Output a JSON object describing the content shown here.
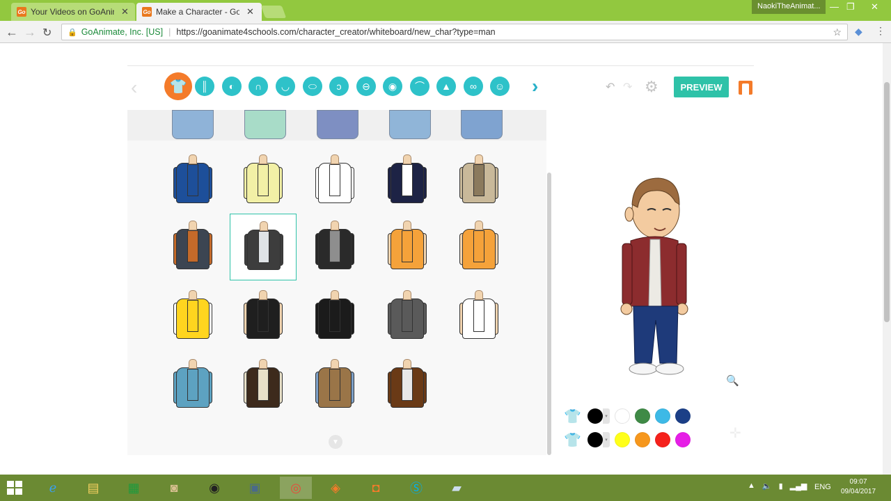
{
  "browser": {
    "tabs": [
      {
        "title": "Your Videos on GoAnim",
        "favicon": "Go",
        "close": "✕",
        "active": false
      },
      {
        "title": "Make a Character - GoA",
        "favicon": "Go",
        "close": "✕",
        "active": true
      }
    ],
    "profile": "NaokiTheAnimat...",
    "site_identity": "GoAnimate, Inc. [US]",
    "url": "https://goanimate4schools.com/character_creator/whiteboard/new_char?type=man"
  },
  "toolbar": {
    "categories": [
      {
        "name": "upper-body-icon",
        "glyph": "👕",
        "active": true
      },
      {
        "name": "lower-body-icon",
        "glyph": "║",
        "active": false
      },
      {
        "name": "face-shape-icon",
        "glyph": "◐",
        "active": false
      },
      {
        "name": "hair-icon",
        "glyph": "∩",
        "active": false
      },
      {
        "name": "head-icon",
        "glyph": "◡",
        "active": false
      },
      {
        "name": "mouth-icon",
        "glyph": "⬭",
        "active": false
      },
      {
        "name": "ear-icon",
        "glyph": "ↄ",
        "active": false
      },
      {
        "name": "skin-icon",
        "glyph": "⊖",
        "active": false
      },
      {
        "name": "eye-icon",
        "glyph": "◉",
        "active": false
      },
      {
        "name": "eyebrow-icon",
        "glyph": "⌒",
        "active": false
      },
      {
        "name": "nose-icon",
        "glyph": "▲",
        "active": false
      },
      {
        "name": "glasses-icon",
        "glyph": "∞",
        "active": false
      },
      {
        "name": "accessory-icon",
        "glyph": "☺",
        "active": false
      }
    ],
    "preview_label": "PREVIEW"
  },
  "outfits": [
    {
      "row": 0,
      "col": 0,
      "color": "#1d4f9a",
      "shirt": "#1d4f9a",
      "arms": "#1d4f9a"
    },
    {
      "row": 0,
      "col": 1,
      "color": "#f2f0a6",
      "shirt": "#f2f0a6",
      "arms": "#f2f0a6"
    },
    {
      "row": 0,
      "col": 2,
      "color": "#ffffff",
      "shirt": "#ffffff",
      "arms": "#ffffff"
    },
    {
      "row": 0,
      "col": 3,
      "color": "#1d2345",
      "shirt": "#ffffff",
      "arms": "#1d2345"
    },
    {
      "row": 0,
      "col": 4,
      "color": "#c9b99a",
      "shirt": "#8b7a5d",
      "arms": "#c9b99a"
    },
    {
      "row": 1,
      "col": 0,
      "color": "#3c4552",
      "shirt": "#c46a2a",
      "arms": "#c46a2a"
    },
    {
      "row": 1,
      "col": 1,
      "color": "#3d3d3d",
      "shirt": "#dfe3e6",
      "arms": "#3d3d3d",
      "selected": true
    },
    {
      "row": 1,
      "col": 2,
      "color": "#2a2a2a",
      "shirt": "#8e8e8e",
      "arms": "#2a2a2a"
    },
    {
      "row": 1,
      "col": 3,
      "color": "#f5a23a",
      "shirt": "#f5a23a",
      "arms": "#f1d4b0"
    },
    {
      "row": 1,
      "col": 4,
      "color": "#f5a23a",
      "shirt": "#f5a23a",
      "arms": "#f1d4b0"
    },
    {
      "row": 2,
      "col": 0,
      "color": "#ffd51f",
      "shirt": "#ffd51f",
      "arms": "#ffffff"
    },
    {
      "row": 2,
      "col": 1,
      "color": "#1f1f1f",
      "shirt": "#1f1f1f",
      "arms": "#f1d4b0"
    },
    {
      "row": 2,
      "col": 2,
      "color": "#1b1b1b",
      "shirt": "#1b1b1b",
      "arms": "#1b1b1b"
    },
    {
      "row": 2,
      "col": 3,
      "color": "#5a5a5a",
      "shirt": "#5a5a5a",
      "arms": "#5a5a5a"
    },
    {
      "row": 2,
      "col": 4,
      "color": "#ffffff",
      "shirt": "#ffffff",
      "arms": "#f1d4b0"
    },
    {
      "row": 3,
      "col": 0,
      "color": "#5da2c1",
      "shirt": "#5da2c1",
      "arms": "#5da2c1"
    },
    {
      "row": 3,
      "col": 1,
      "color": "#3d2a1c",
      "shirt": "#e8e0c8",
      "arms": "#e8e0c8"
    },
    {
      "row": 3,
      "col": 2,
      "color": "#9a7548",
      "shirt": "#9a7548",
      "arms": "#7ea1c9"
    },
    {
      "row": 3,
      "col": 3,
      "color": "#6a3a16",
      "shirt": "#e8e8e8",
      "arms": "#6a3a16"
    }
  ],
  "partial_top_row": [
    "#8fb3d8",
    "#a8dcc8",
    "#7e8fc2",
    "#90b5d8",
    "#7fa3d0"
  ],
  "colors": {
    "row1": [
      "#000000",
      "#ffffff",
      "#3f8a46",
      "#3db9e6",
      "#1b3f87"
    ],
    "row2": [
      "#000000",
      "#ffff1a",
      "#f6971d",
      "#f5211c",
      "#e61ee6"
    ]
  },
  "taskbar": {
    "lang": "ENG",
    "time": "09:07",
    "date": "09/04/2017"
  }
}
